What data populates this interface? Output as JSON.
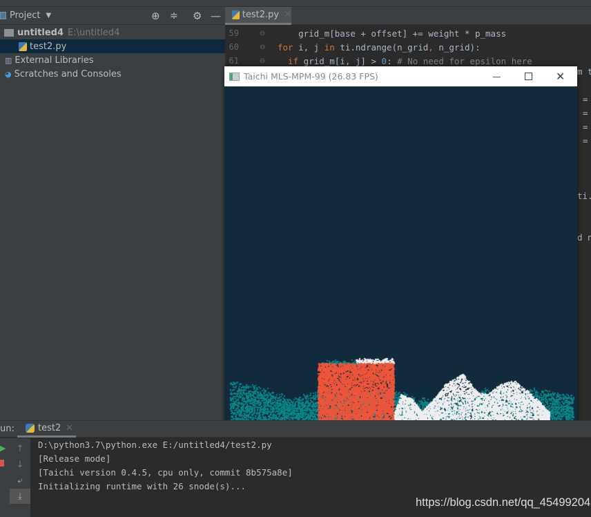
{
  "project": {
    "title": "Project",
    "root_name": "untitled4",
    "root_path": "E:\\untitled4",
    "file": "test2.py",
    "external": "External Libraries",
    "scratches": "Scratches and Consoles"
  },
  "editor": {
    "tab": "test2.py",
    "lines": [
      {
        "n": "59",
        "parts": [
          [
            "",
            "    grid_m[base + offset] += weight * p_mass"
          ]
        ]
      },
      {
        "n": "60",
        "parts": [
          [
            "kw",
            "for"
          ],
          [
            "",
            " i, j "
          ],
          [
            "kw",
            "in"
          ],
          [
            "",
            " ti.ndrange(n_grid"
          ],
          [
            "kw",
            ","
          ],
          [
            "",
            " n_grid):"
          ]
        ]
      },
      {
        "n": "61",
        "parts": [
          [
            "kw",
            "  if"
          ],
          [
            "",
            " grid_m[i, j] > "
          ],
          [
            "num",
            "0"
          ],
          [
            "",
            ": "
          ],
          [
            "cm",
            "# No need for epsilon here"
          ]
        ]
      }
    ],
    "fragments": [
      "m t",
      "=",
      "=",
      "=",
      "=",
      "ti.",
      "d n"
    ]
  },
  "taichi_window": {
    "title": "Taichi MLS-MPM-99 (26.83 FPS)",
    "colors": {
      "background": "#112b3c",
      "water": "#068587",
      "jelly": "#ed553b",
      "snow": "#eeeef0"
    }
  },
  "run": {
    "label": "un:",
    "tab": "test2",
    "console": [
      "D:\\python3.7\\python.exe E:/untitled4/test2.py",
      "[Release mode]",
      "[Taichi version 0.4.5, cpu only, commit 8b575a8e]",
      "Initializing runtime with 26 snode(s)..."
    ]
  },
  "watermark": "https://blog.csdn.net/qq_45499204"
}
